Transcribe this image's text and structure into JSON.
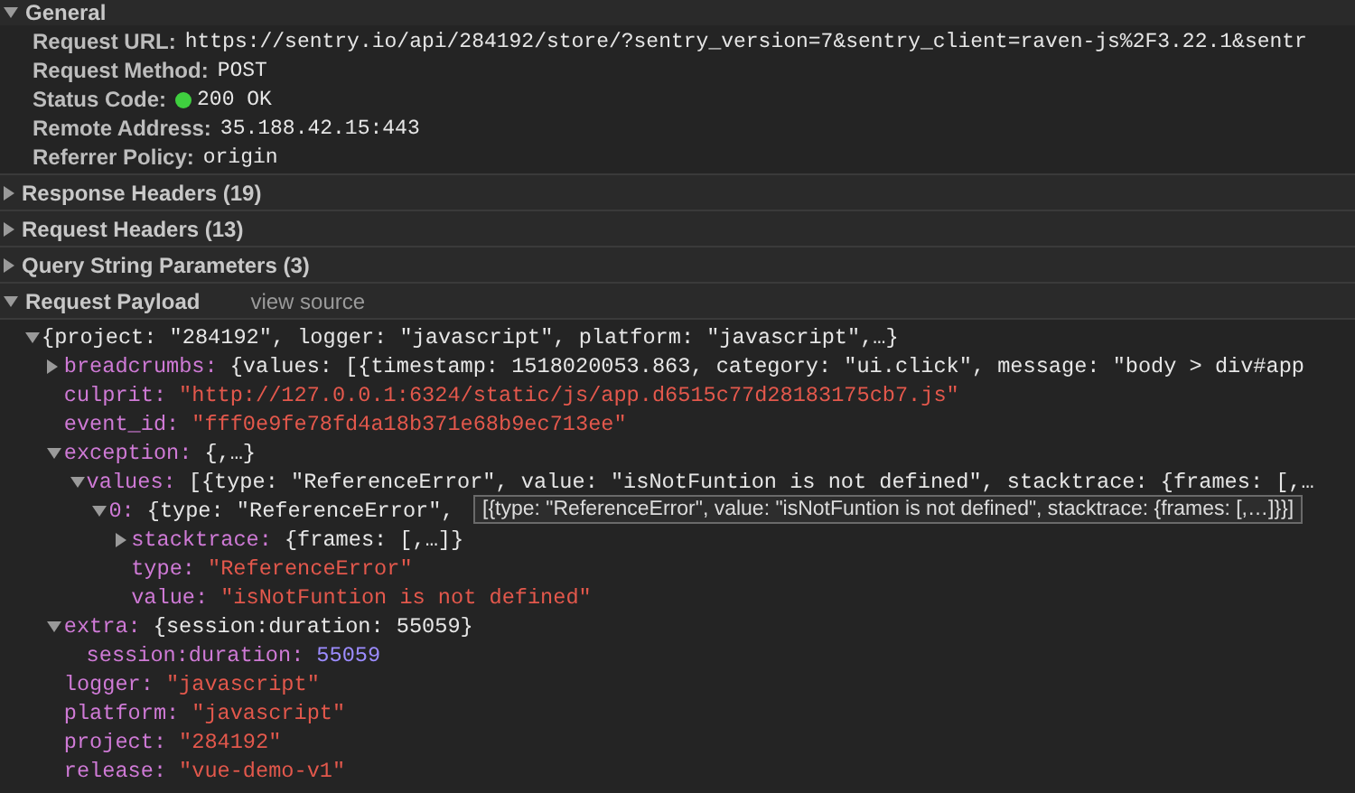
{
  "general": {
    "title": "General",
    "expanded": true,
    "rows": [
      {
        "label": "Request URL:",
        "value": "https://sentry.io/api/284192/store/?sentry_version=7&sentry_client=raven-js%2F3.22.1&sentr",
        "kind": "text"
      },
      {
        "label": "Request Method:",
        "value": "POST",
        "kind": "text"
      },
      {
        "label": "Status Code:",
        "value": "200 OK",
        "kind": "status"
      },
      {
        "label": "Remote Address:",
        "value": "35.188.42.15:443",
        "kind": "text"
      },
      {
        "label": "Referrer Policy:",
        "value": "origin",
        "kind": "text"
      }
    ]
  },
  "sections": [
    {
      "title": "Response Headers (19)",
      "expanded": false
    },
    {
      "title": "Request Headers (13)",
      "expanded": false
    },
    {
      "title": "Query String Parameters (3)",
      "expanded": false
    },
    {
      "title": "Request Payload",
      "expanded": true,
      "link": "view source"
    }
  ],
  "payload": {
    "value": "{project: \"284192\", logger: \"javascript\", platform: \"javascript\",…}",
    "kind": "object",
    "expanded": true,
    "children": [
      {
        "key": "breadcrumbs:",
        "value": "{values: [{timestamp: 1518020053.863, category: \"ui.click\", message: \"body > div#app",
        "kind": "object",
        "expanded": false
      },
      {
        "key": "culprit:",
        "value": "\"http://127.0.0.1:6324/static/js/app.d6515c77d28183175cb7.js\"",
        "kind": "string"
      },
      {
        "key": "event_id:",
        "value": "\"fff0e9fe78fd4a18b371e68b9ec713ee\"",
        "kind": "string"
      },
      {
        "key": "exception:",
        "value": "{,…}",
        "kind": "object",
        "expanded": true,
        "children": [
          {
            "key": "values:",
            "value": "[{type: \"ReferenceError\", value: \"isNotFuntion is not defined\", stacktrace: {frames: [,…",
            "kind": "object",
            "expanded": true,
            "children": [
              {
                "key": "0:",
                "value": "{type: \"ReferenceError\",",
                "kind": "object",
                "expanded": true,
                "tooltip": "[{type: \"ReferenceError\", value: \"isNotFuntion is not defined\", stacktrace: {frames: [,…]}}]",
                "children": [
                  {
                    "key": "stacktrace:",
                    "value": "{frames: [,…]}",
                    "kind": "object",
                    "expanded": false
                  },
                  {
                    "key": "type:",
                    "value": "\"ReferenceError\"",
                    "kind": "string"
                  },
                  {
                    "key": "value:",
                    "value": "\"isNotFuntion is not defined\"",
                    "kind": "string"
                  }
                ]
              }
            ]
          }
        ]
      },
      {
        "key": "extra:",
        "value": "{session:duration: 55059}",
        "kind": "object",
        "expanded": true,
        "children": [
          {
            "key": "session:duration:",
            "value": "55059",
            "kind": "number"
          }
        ]
      },
      {
        "key": "logger:",
        "value": "\"javascript\"",
        "kind": "string"
      },
      {
        "key": "platform:",
        "value": "\"javascript\"",
        "kind": "string"
      },
      {
        "key": "project:",
        "value": "\"284192\"",
        "kind": "string"
      },
      {
        "key": "release:",
        "value": "\"vue-demo-v1\"",
        "kind": "string"
      }
    ]
  }
}
